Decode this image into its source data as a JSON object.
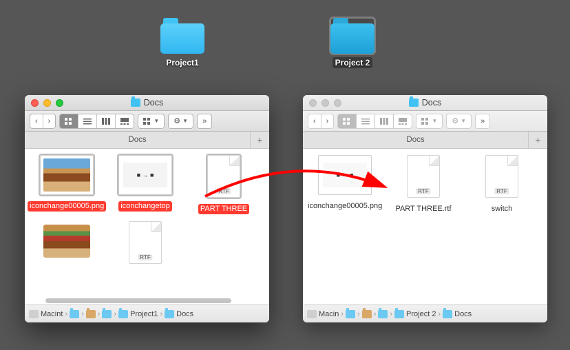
{
  "desktop": {
    "folders": [
      {
        "label": "Project1",
        "selected": false
      },
      {
        "label": "Project 2",
        "selected": true
      }
    ]
  },
  "window1": {
    "title": "Docs",
    "tab": "Docs",
    "files": [
      {
        "name": "iconchange00005.png",
        "type": "image",
        "selected": true
      },
      {
        "name": "iconchangetop",
        "type": "image",
        "selected": true
      },
      {
        "name": "PART THREE",
        "type": "rtf",
        "selected": true
      },
      {
        "name": "",
        "type": "image",
        "selected": false
      },
      {
        "name": "",
        "type": "rtf",
        "selected": false
      }
    ],
    "path": [
      "Macint",
      "",
      "",
      "",
      "Project1",
      "Docs"
    ]
  },
  "window2": {
    "title": "Docs",
    "tab": "Docs",
    "files": [
      {
        "name": "iconchange00005.png",
        "type": "image",
        "selected": false
      },
      {
        "name": "PART THREE.rtf",
        "type": "rtf",
        "selected": false
      },
      {
        "name": "switch",
        "type": "rtf",
        "selected": false
      }
    ],
    "path": [
      "Macin",
      "",
      "",
      "",
      "Project 2",
      "Docs"
    ]
  },
  "annotation_arrow_color": "#ff0000"
}
